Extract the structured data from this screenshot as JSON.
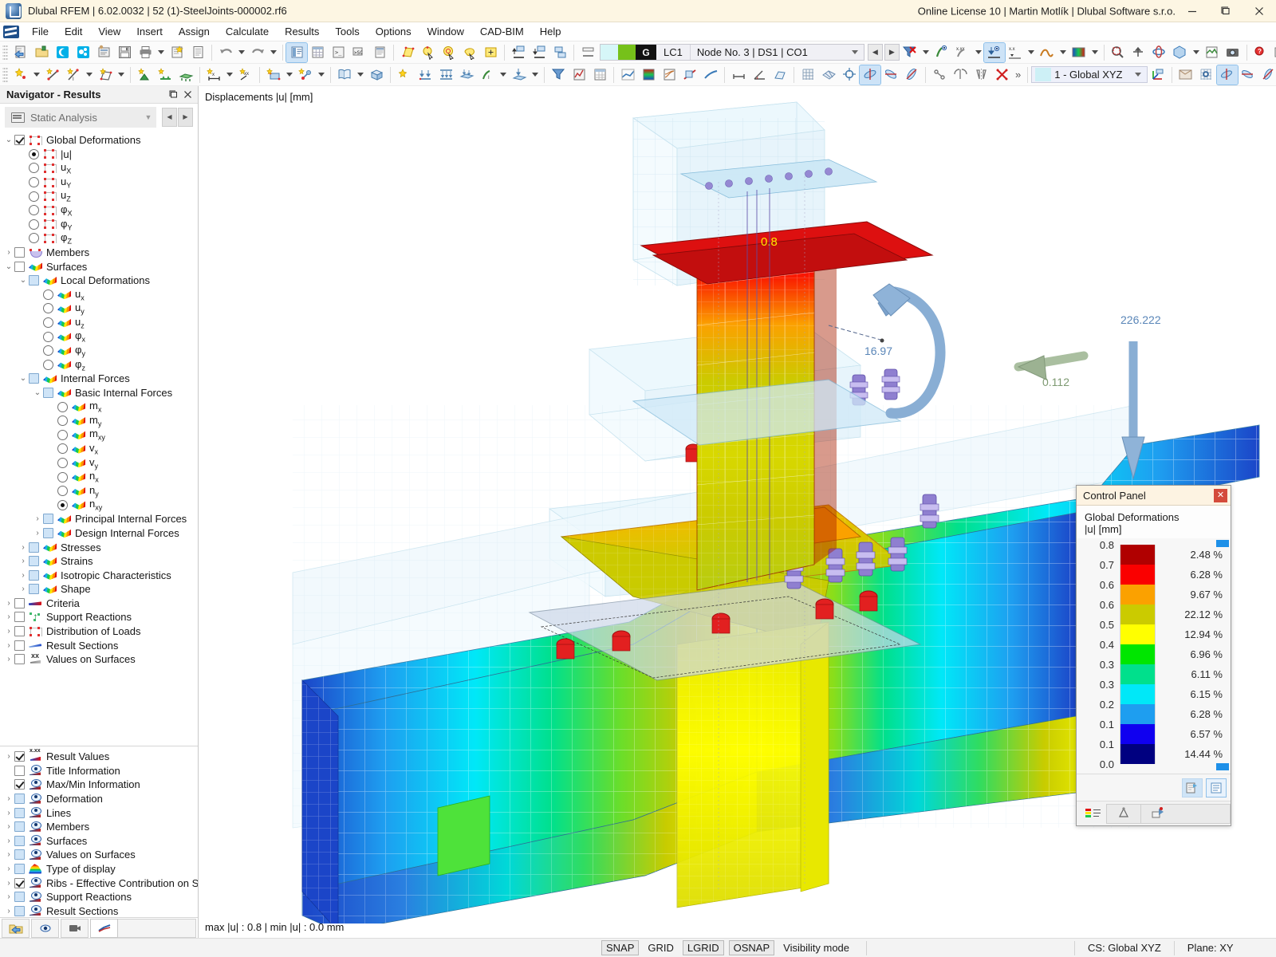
{
  "window": {
    "title": "Dlubal RFEM | 6.02.0032 | 52 (1)-SteelJoints-000002.rf6",
    "license": "Online License 10 | Martin Motlík | Dlubal Software s.r.o.",
    "minimize": "—",
    "maximize": "▭",
    "close": "✕"
  },
  "menu": [
    "File",
    "Edit",
    "View",
    "Insert",
    "Assign",
    "Calculate",
    "Results",
    "Tools",
    "Options",
    "Window",
    "CAD-BIM",
    "Help"
  ],
  "toolbar2": {
    "load_case_tag": "G",
    "load_case": "LC1",
    "selection": "Node No. 3 | DS1 | CO1",
    "coord_system": "1 - Global XYZ"
  },
  "navigator": {
    "header_title": "Navigator - Results",
    "analysis_select": "Static Analysis",
    "tree": [
      {
        "label": "Global Deformations",
        "indent": 0,
        "expander": "v",
        "control": "checkbox-checked",
        "icon": "frame-icon"
      },
      {
        "label": "|u|",
        "indent": 1,
        "expander": "",
        "control": "radio-on",
        "icon": "frame-icon"
      },
      {
        "label": "u",
        "sub": "X",
        "indent": 1,
        "expander": "",
        "control": "radio",
        "icon": "frame-icon"
      },
      {
        "label": "u",
        "sub": "Y",
        "indent": 1,
        "expander": "",
        "control": "radio",
        "icon": "frame-icon"
      },
      {
        "label": "u",
        "sub": "Z",
        "indent": 1,
        "expander": "",
        "control": "radio",
        "icon": "frame-icon"
      },
      {
        "label": "φ",
        "sub": "X",
        "indent": 1,
        "expander": "",
        "control": "radio",
        "icon": "frame-icon"
      },
      {
        "label": "φ",
        "sub": "Y",
        "indent": 1,
        "expander": "",
        "control": "radio",
        "icon": "frame-icon"
      },
      {
        "label": "φ",
        "sub": "Z",
        "indent": 1,
        "expander": "",
        "control": "radio",
        "icon": "frame-icon"
      },
      {
        "label": "Members",
        "indent": 0,
        "expander": ">",
        "control": "checkbox",
        "icon": "member-icon"
      },
      {
        "label": "Surfaces",
        "indent": 0,
        "expander": "v",
        "control": "checkbox",
        "icon": "surface-icon"
      },
      {
        "label": "Local Deformations",
        "indent": 1,
        "expander": "v",
        "control": "checkbox-blue",
        "icon": "surface-icon"
      },
      {
        "label": "u",
        "sub": "x",
        "indent": 2,
        "expander": "",
        "control": "radio",
        "icon": "surface-icon"
      },
      {
        "label": "u",
        "sub": "y",
        "indent": 2,
        "expander": "",
        "control": "radio",
        "icon": "surface-icon"
      },
      {
        "label": "u",
        "sub": "z",
        "indent": 2,
        "expander": "",
        "control": "radio",
        "icon": "surface-icon"
      },
      {
        "label": "φ",
        "sub": "x",
        "indent": 2,
        "expander": "",
        "control": "radio",
        "icon": "surface-icon"
      },
      {
        "label": "φ",
        "sub": "y",
        "indent": 2,
        "expander": "",
        "control": "radio",
        "icon": "surface-icon"
      },
      {
        "label": "φ",
        "sub": "z",
        "indent": 2,
        "expander": "",
        "control": "radio",
        "icon": "surface-icon"
      },
      {
        "label": "Internal Forces",
        "indent": 1,
        "expander": "v",
        "control": "checkbox-blue",
        "icon": "surface-icon"
      },
      {
        "label": "Basic Internal Forces",
        "indent": 2,
        "expander": "v",
        "control": "checkbox-blue",
        "icon": "surface-icon"
      },
      {
        "label": "m",
        "sub": "x",
        "indent": 3,
        "expander": "",
        "control": "radio",
        "icon": "surface-icon"
      },
      {
        "label": "m",
        "sub": "y",
        "indent": 3,
        "expander": "",
        "control": "radio",
        "icon": "surface-icon"
      },
      {
        "label": "m",
        "sub": "xy",
        "indent": 3,
        "expander": "",
        "control": "radio",
        "icon": "surface-icon"
      },
      {
        "label": "v",
        "sub": "x",
        "indent": 3,
        "expander": "",
        "control": "radio",
        "icon": "surface-icon"
      },
      {
        "label": "v",
        "sub": "y",
        "indent": 3,
        "expander": "",
        "control": "radio",
        "icon": "surface-icon"
      },
      {
        "label": "n",
        "sub": "x",
        "indent": 3,
        "expander": "",
        "control": "radio",
        "icon": "surface-icon"
      },
      {
        "label": "n",
        "sub": "y",
        "indent": 3,
        "expander": "",
        "control": "radio",
        "icon": "surface-icon"
      },
      {
        "label": "n",
        "sub": "xy",
        "indent": 3,
        "expander": "",
        "control": "radio-on",
        "icon": "surface-icon"
      },
      {
        "label": "Principal Internal Forces",
        "indent": 2,
        "expander": ">",
        "control": "checkbox-blue",
        "icon": "surface-icon"
      },
      {
        "label": "Design Internal Forces",
        "indent": 2,
        "expander": ">",
        "control": "checkbox-blue",
        "icon": "surface-icon"
      },
      {
        "label": "Stresses",
        "indent": 1,
        "expander": ">",
        "control": "checkbox-blue",
        "icon": "surface-icon"
      },
      {
        "label": "Strains",
        "indent": 1,
        "expander": ">",
        "control": "checkbox-blue",
        "icon": "surface-icon"
      },
      {
        "label": "Isotropic Characteristics",
        "indent": 1,
        "expander": ">",
        "control": "checkbox-blue",
        "icon": "surface-icon"
      },
      {
        "label": "Shape",
        "indent": 1,
        "expander": ">",
        "control": "checkbox-blue",
        "icon": "surface-icon"
      },
      {
        "label": "Criteria",
        "indent": 0,
        "expander": ">",
        "control": "checkbox",
        "icon": "criteria-icon"
      },
      {
        "label": "Support Reactions",
        "indent": 0,
        "expander": ">",
        "control": "checkbox",
        "icon": "reaction-icon"
      },
      {
        "label": "Distribution of Loads",
        "indent": 0,
        "expander": ">",
        "control": "checkbox",
        "icon": "frame-icon"
      },
      {
        "label": "Result Sections",
        "indent": 0,
        "expander": ">",
        "control": "checkbox",
        "icon": "result-section-icon"
      },
      {
        "label": "Values on Surfaces",
        "indent": 0,
        "expander": ">",
        "control": "checkbox",
        "icon": "values-on-surfaces-icon"
      }
    ],
    "tree2": [
      {
        "label": "Result Values",
        "indent": 0,
        "expander": ">",
        "control": "checkbox-checked",
        "icon": "result-values-icon"
      },
      {
        "label": "Title Information",
        "indent": 0,
        "expander": "",
        "control": "checkbox",
        "icon": "eye-icon"
      },
      {
        "label": "Max/Min Information",
        "indent": 0,
        "expander": "",
        "control": "checkbox-checked",
        "icon": "eye-icon"
      },
      {
        "label": "Deformation",
        "indent": 0,
        "expander": ">",
        "control": "checkbox-blue",
        "icon": "eye-icon"
      },
      {
        "label": "Lines",
        "indent": 0,
        "expander": ">",
        "control": "checkbox-blue",
        "icon": "eye-icon"
      },
      {
        "label": "Members",
        "indent": 0,
        "expander": ">",
        "control": "checkbox-blue",
        "icon": "eye-icon"
      },
      {
        "label": "Surfaces",
        "indent": 0,
        "expander": ">",
        "control": "checkbox-blue",
        "icon": "eye-icon"
      },
      {
        "label": "Values on Surfaces",
        "indent": 0,
        "expander": ">",
        "control": "checkbox-blue",
        "icon": "eye-icon"
      },
      {
        "label": "Type of display",
        "indent": 0,
        "expander": ">",
        "control": "checkbox-blue",
        "icon": "rainbow-icon"
      },
      {
        "label": "Ribs - Effective Contribution on Sur...",
        "indent": 0,
        "expander": ">",
        "control": "checkbox-checked",
        "icon": "eye-icon"
      },
      {
        "label": "Support Reactions",
        "indent": 0,
        "expander": ">",
        "control": "checkbox-blue",
        "icon": "eye-icon"
      },
      {
        "label": "Result Sections",
        "indent": 0,
        "expander": ">",
        "control": "checkbox-blue",
        "icon": "eye-icon"
      }
    ]
  },
  "viewport": {
    "title": "Displacements |u| [mm]",
    "status": "max |u| : 0.8 | min |u| : 0.0 mm",
    "annotations": [
      {
        "name": "moment-value",
        "text": "16.97",
        "color": "#5a86b8"
      },
      {
        "name": "force-value-small",
        "text": "0.112",
        "color": "#7e9a72"
      },
      {
        "name": "force-value-large",
        "text": "226.222",
        "color": "#5a86b8"
      },
      {
        "name": "max-displacement-label",
        "text": "0.8",
        "color": "#ffe800"
      }
    ]
  },
  "control_panel": {
    "title": "Control Panel",
    "close_label": "✕",
    "heading_1": "Global Deformations",
    "heading_2": "|u| [mm]",
    "chart_data": {
      "type": "bar",
      "title": "Global Deformations |u| [mm]",
      "xlabel": "",
      "ylabel": "|u| [mm]",
      "legend_position": "right",
      "axis_values": [
        "0.8",
        "0.7",
        "0.6",
        "0.6",
        "0.5",
        "0.4",
        "0.3",
        "0.3",
        "0.2",
        "0.1",
        "0.1",
        "0.0"
      ],
      "categories": [
        "0.7-0.8",
        "0.6-0.7",
        "0.6-0.6",
        "0.5-0.6",
        "0.4-0.5",
        "0.3-0.4",
        "0.3-0.3",
        "0.2-0.3",
        "0.1-0.2",
        "0.1-0.1",
        "0.0-0.1"
      ],
      "values": [
        2.48,
        6.28,
        9.67,
        22.12,
        12.94,
        6.96,
        6.11,
        6.15,
        6.28,
        6.57,
        14.44
      ],
      "labels": [
        "2.48 %",
        "6.28 %",
        "9.67 %",
        "22.12 %",
        "12.94 %",
        "6.96 %",
        "6.11 %",
        "6.15 %",
        "6.28 %",
        "6.57 %",
        "14.44 %"
      ],
      "colors": [
        "#b00000",
        "#fa0000",
        "#fba100",
        "#cbcb00",
        "#ffff00",
        "#00e600",
        "#00e08c",
        "#00e8f8",
        "#1e9ef0",
        "#1000f0",
        "#000080"
      ]
    }
  },
  "statusbar": {
    "snap": "SNAP",
    "grid": "GRID",
    "lgrid": "LGRID",
    "osnap": "OSNAP",
    "visibility": "Visibility mode",
    "cs": "CS: Global XYZ",
    "plane": "Plane: XY"
  }
}
